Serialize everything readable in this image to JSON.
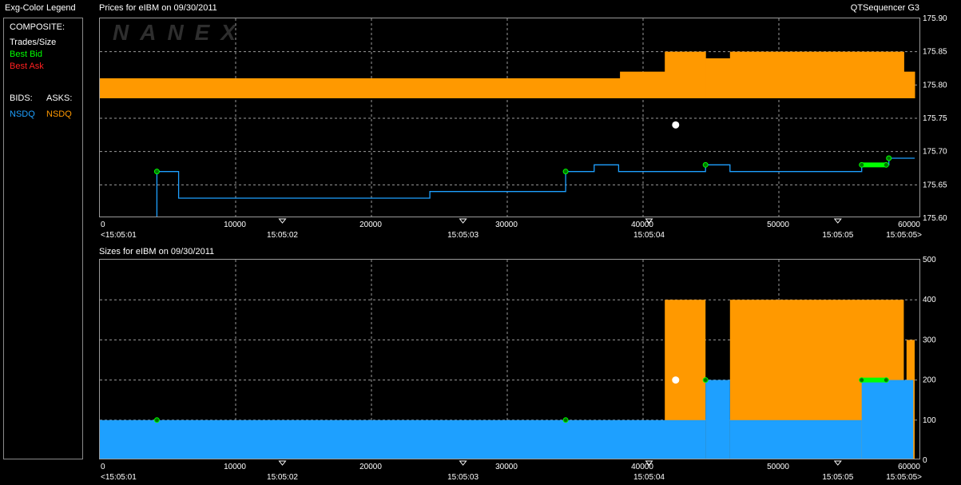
{
  "legend": {
    "title": "Exg-Color Legend",
    "composite_label": "COMPOSITE:",
    "trades_label": "Trades/Size",
    "best_bid_label": "Best Bid",
    "best_ask_label": "Best Ask",
    "bids_label": "BIDS:",
    "asks_label": "ASKS:",
    "bid_exchange": "NSDQ",
    "ask_exchange": "NSDQ"
  },
  "app_title": "QTSequencer G3",
  "watermark": "NANEX",
  "colors": {
    "ask": "#ff9900",
    "bid": "#1ea0ff",
    "best_bid": "#00ff00",
    "best_ask": "#ff2020",
    "trade": "#ffffff",
    "grid": "#9a9a9a"
  },
  "chart_data": [
    {
      "type": "area",
      "title": "Prices for  eIBM  on  09/30/2011",
      "xlim": [
        0,
        60000
      ],
      "ylim": [
        175.6,
        175.9
      ],
      "grid": true,
      "x_ticks": [
        0,
        10000,
        20000,
        30000,
        40000,
        50000,
        60000
      ],
      "x_tick_labels": [
        "0",
        "10000",
        "20000",
        "30000",
        "40000",
        "50000",
        "60000"
      ],
      "y_ticks": [
        175.6,
        175.65,
        175.7,
        175.75,
        175.8,
        175.85,
        175.9
      ],
      "y_tick_labels": [
        "175.60",
        "175.65",
        "175.70",
        "175.75",
        "175.80",
        "175.85",
        "175.90"
      ],
      "time_labels": [
        {
          "x": 0,
          "label": "<15:05:01"
        },
        {
          "x": 13500,
          "label": "15:05:02"
        },
        {
          "x": 26800,
          "label": "15:05:03"
        },
        {
          "x": 40500,
          "label": "15:05:04"
        },
        {
          "x": 54400,
          "label": "15:05:05"
        },
        {
          "x": 60000,
          "label": "15:05:05>"
        }
      ],
      "series": [
        {
          "name": "NSDQ",
          "role": "ask",
          "segments": [
            {
              "x0": 0,
              "x1": 38300,
              "low": 175.78,
              "high": 175.81
            },
            {
              "x0": 38300,
              "x1": 41600,
              "low": 175.78,
              "high": 175.82
            },
            {
              "x0": 41600,
              "x1": 44600,
              "low": 175.78,
              "high": 175.85
            },
            {
              "x0": 44600,
              "x1": 46400,
              "low": 175.78,
              "high": 175.84
            },
            {
              "x0": 46400,
              "x1": 59200,
              "low": 175.78,
              "high": 175.85
            },
            {
              "x0": 59200,
              "x1": 60000,
              "low": 175.78,
              "high": 175.82
            }
          ]
        },
        {
          "name": "NSDQ",
          "role": "bid",
          "steps": [
            {
              "x": 4200,
              "y": 175.67
            },
            {
              "x": 5800,
              "y": 175.63
            },
            {
              "x": 24300,
              "y": 175.64
            },
            {
              "x": 34300,
              "y": 175.67
            },
            {
              "x": 35100,
              "y": 175.67
            },
            {
              "x": 36400,
              "y": 175.68
            },
            {
              "x": 38200,
              "y": 175.67
            },
            {
              "x": 44600,
              "y": 175.68
            },
            {
              "x": 46400,
              "y": 175.67
            },
            {
              "x": 56100,
              "y": 175.68
            },
            {
              "x": 58100,
              "y": 175.69
            },
            {
              "x": 60000,
              "y": 175.69
            }
          ]
        }
      ],
      "trades": [
        {
          "x": 42400,
          "y": 175.74
        }
      ],
      "bid_markers": [
        {
          "x": 4200,
          "y": 175.67
        },
        {
          "x": 34300,
          "y": 175.67
        },
        {
          "x": 44600,
          "y": 175.68
        },
        {
          "x": 56100,
          "y": 175.68
        },
        {
          "x": 57900,
          "y": 175.68
        },
        {
          "x": 58100,
          "y": 175.69
        }
      ],
      "best_bid_run": {
        "x0": 56100,
        "x1": 57900,
        "y": 175.68
      }
    },
    {
      "type": "area",
      "title": "Sizes for  eIBM  on  09/30/2011",
      "xlim": [
        0,
        60000
      ],
      "ylim": [
        0,
        500
      ],
      "grid": true,
      "x_ticks": [
        0,
        10000,
        20000,
        30000,
        40000,
        50000,
        60000
      ],
      "x_tick_labels": [
        "0",
        "10000",
        "20000",
        "30000",
        "40000",
        "50000",
        "60000"
      ],
      "y_ticks": [
        0,
        100,
        200,
        300,
        400,
        500
      ],
      "y_tick_labels": [
        "0",
        "100",
        "200",
        "300",
        "400",
        "500"
      ],
      "time_labels": [
        {
          "x": 0,
          "label": "<15:05:01"
        },
        {
          "x": 13500,
          "label": "15:05:02"
        },
        {
          "x": 26800,
          "label": "15:05:03"
        },
        {
          "x": 40500,
          "label": "15:05:04"
        },
        {
          "x": 54400,
          "label": "15:05:05"
        },
        {
          "x": 60000,
          "label": "15:05:05>"
        }
      ],
      "series": [
        {
          "name": "NSDQ",
          "role": "ask",
          "bars": [
            {
              "x0": 41600,
              "x1": 44600,
              "value": 400
            },
            {
              "x0": 46400,
              "x1": 59200,
              "value": 400
            },
            {
              "x0": 59400,
              "x1": 60000,
              "value": 300
            }
          ]
        },
        {
          "name": "NSDQ",
          "role": "bid",
          "bars": [
            {
              "x0": 0,
              "x1": 44600,
              "value": 100
            },
            {
              "x0": 44600,
              "x1": 46400,
              "value": 200
            },
            {
              "x0": 46400,
              "x1": 56100,
              "value": 100
            },
            {
              "x0": 56100,
              "x1": 59900,
              "value": 200
            }
          ]
        }
      ],
      "trades": [
        {
          "x": 42400,
          "y": 200
        }
      ],
      "bid_markers": [
        {
          "x": 4200,
          "y": 100
        },
        {
          "x": 34300,
          "y": 100
        },
        {
          "x": 44600,
          "y": 200
        },
        {
          "x": 56100,
          "y": 200
        },
        {
          "x": 57900,
          "y": 200
        }
      ],
      "best_bid_run": {
        "x0": 56100,
        "x1": 57900,
        "y": 200
      }
    }
  ]
}
